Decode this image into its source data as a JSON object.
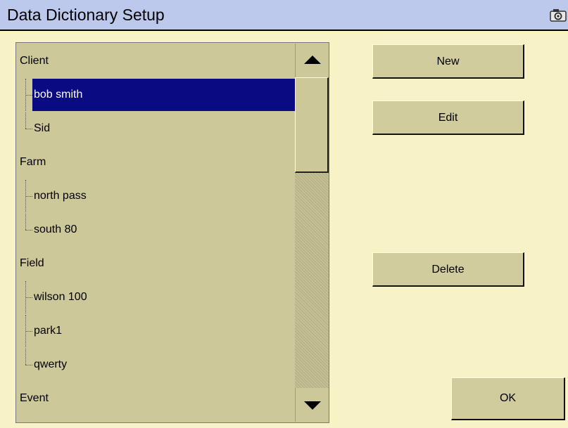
{
  "window": {
    "title": "Data Dictionary Setup",
    "camera_icon": "camera-icon"
  },
  "tree": {
    "items": [
      {
        "label": "Client",
        "level": 0
      },
      {
        "label": "bob smith",
        "level": 1,
        "selected": true
      },
      {
        "label": "Sid",
        "level": 1,
        "last": true
      },
      {
        "label": "Farm",
        "level": 0
      },
      {
        "label": "north pass",
        "level": 1
      },
      {
        "label": "south 80",
        "level": 1,
        "last": true
      },
      {
        "label": "Field",
        "level": 0
      },
      {
        "label": "wilson 100",
        "level": 1
      },
      {
        "label": "park1",
        "level": 1
      },
      {
        "label": "qwerty",
        "level": 1,
        "last": true
      },
      {
        "label": "Event",
        "level": 0
      }
    ]
  },
  "scrollbar": {
    "up_icon": "arrow-up-icon",
    "down_icon": "arrow-down-icon"
  },
  "buttons": {
    "new": "New",
    "edit": "Edit",
    "delete": "Delete",
    "ok": "OK"
  },
  "colors": {
    "background": "#f7f3c6",
    "titlebar": "#bcc8ec",
    "panel": "#ccc89a",
    "selection": "#0a0a82"
  }
}
